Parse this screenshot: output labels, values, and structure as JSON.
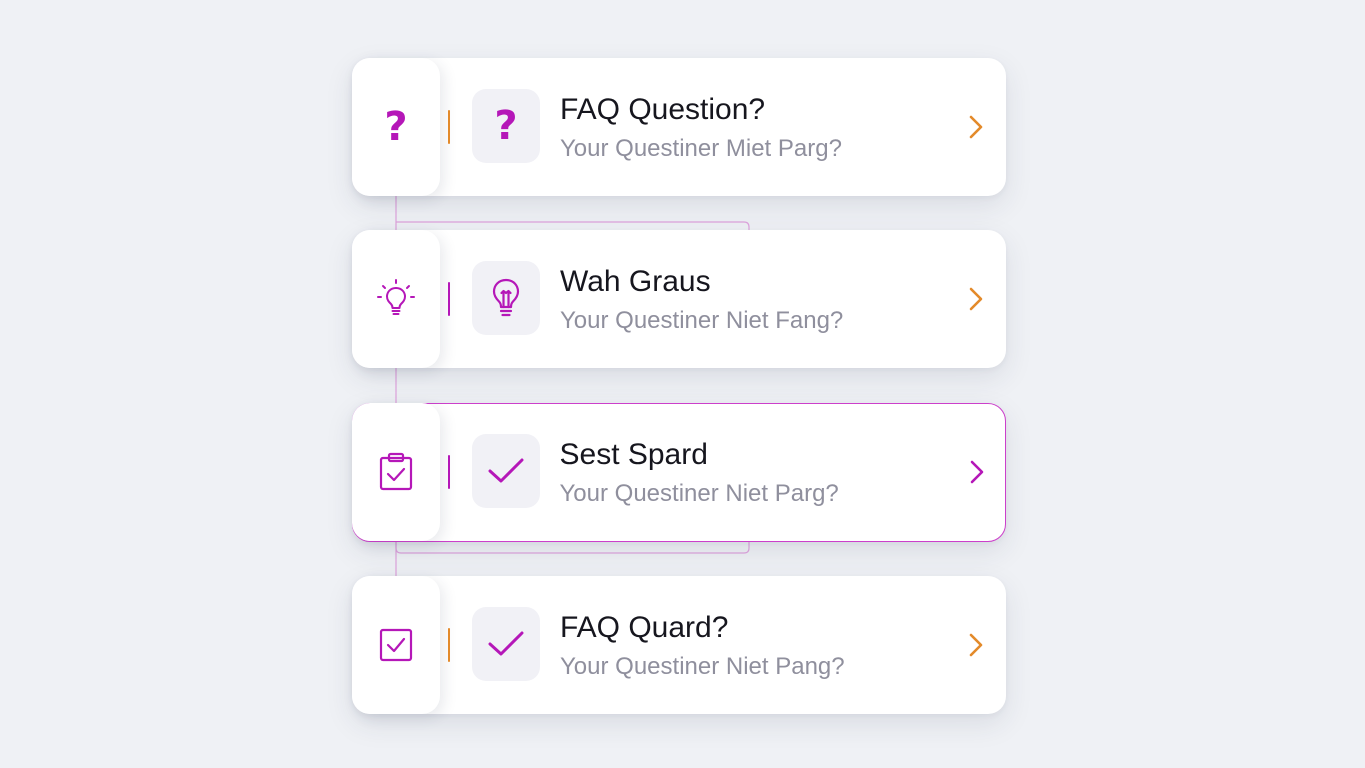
{
  "colors": {
    "accent_magenta": "#b517b8",
    "accent_orange": "#e38a2a",
    "background": "#eff1f5",
    "card": "#ffffff",
    "title_text": "#16161e",
    "subtitle_text": "#8f8f9d"
  },
  "faq": {
    "items": [
      {
        "title": "FAQ Question?",
        "subtitle": "Your Questiner Miet Parg?",
        "side_icon": "question-mark-icon",
        "tile_icon": "question-mark-icon",
        "side_glyph": "?",
        "tile_glyph": "?",
        "divider_color": "orange",
        "chevron_color": "orange"
      },
      {
        "title": "Wah Graus",
        "subtitle": "Your Questiner Niet Fang?",
        "side_icon": "lightbulb-icon",
        "tile_icon": "lightbulb-icon",
        "divider_color": "magenta",
        "chevron_color": "orange"
      },
      {
        "title": "Sest Spard",
        "subtitle": "Your Questiner Niet Parg?",
        "side_icon": "clipboard-check-icon",
        "tile_icon": "checkmark-icon",
        "divider_color": "magenta",
        "chevron_color": "magenta",
        "selected": true
      },
      {
        "title": "FAQ Quard?",
        "subtitle": "Your Questiner Niet Pang?",
        "side_icon": "checkbox-icon",
        "tile_icon": "checkmark-icon",
        "divider_color": "orange",
        "chevron_color": "orange"
      }
    ]
  }
}
